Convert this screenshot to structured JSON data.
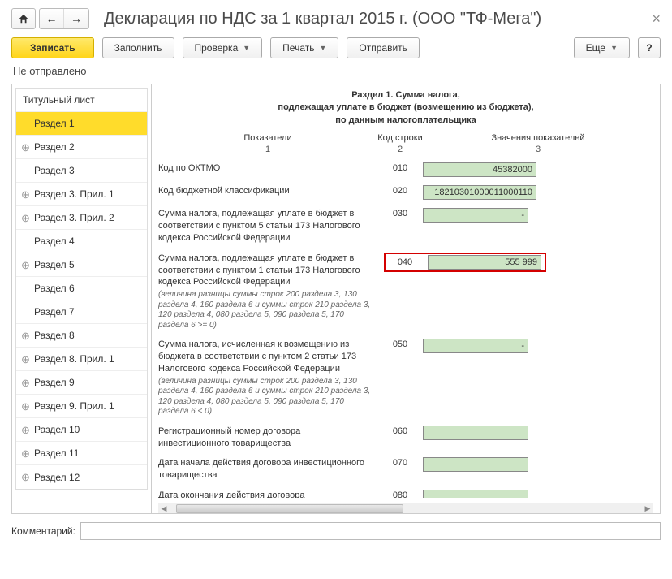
{
  "title": "Декларация по НДС за 1 квартал 2015 г. (ООО \"ТФ-Мега\")",
  "toolbar": {
    "record": "Записать",
    "fill": "Заполнить",
    "check": "Проверка",
    "print": "Печать",
    "send": "Отправить",
    "more": "Еще",
    "help": "?"
  },
  "status": "Не отправлено",
  "sidebar": [
    {
      "label": "Титульный лист",
      "expand": false,
      "first": true
    },
    {
      "label": "Раздел 1",
      "expand": false,
      "active": true
    },
    {
      "label": "Раздел 2",
      "expand": true
    },
    {
      "label": "Раздел 3",
      "expand": false
    },
    {
      "label": "Раздел 3. Прил. 1",
      "expand": true
    },
    {
      "label": "Раздел 3. Прил. 2",
      "expand": true
    },
    {
      "label": "Раздел 4",
      "expand": false
    },
    {
      "label": "Раздел 5",
      "expand": true
    },
    {
      "label": "Раздел 6",
      "expand": false
    },
    {
      "label": "Раздел 7",
      "expand": false
    },
    {
      "label": "Раздел 8",
      "expand": true
    },
    {
      "label": "Раздел 8. Прил. 1",
      "expand": true
    },
    {
      "label": "Раздел 9",
      "expand": true
    },
    {
      "label": "Раздел 9. Прил. 1",
      "expand": true
    },
    {
      "label": "Раздел 10",
      "expand": true
    },
    {
      "label": "Раздел 11",
      "expand": true
    },
    {
      "label": "Раздел 12",
      "expand": true
    }
  ],
  "section": {
    "header1": "Раздел 1. Сумма налога,",
    "header2": "подлежащая уплате в бюджет (возмещению из бюджета),",
    "header3": "по данным налогоплательщика",
    "cols": {
      "c1": "Показатели",
      "c2": "Код строки",
      "c3": "Значения показателей"
    },
    "subs": {
      "c1": "1",
      "c2": "2",
      "c3": "3"
    }
  },
  "rows": [
    {
      "label": "Код по ОКТМО",
      "code": "010",
      "value": "45382000"
    },
    {
      "label": "Код бюджетной классификации",
      "code": "020",
      "value": "18210301000011000110"
    },
    {
      "label": "Сумма налога, подлежащая уплате в бюджет в соответствии с пунктом 5 статьи 173 Налогового кодекса Российской Федерации",
      "code": "030",
      "value": "-"
    },
    {
      "label": "Сумма налога, подлежащая уплате в бюджет в соответствии с пунктом 1 статьи 173 Налогового кодекса Российской Федерации",
      "note": "(величина разницы суммы строк 200 раздела 3, 130 раздела 4, 160 раздела 6 и суммы строк 210 раздела 3, 120 раздела 4, 080 раздела 5, 090 раздела 5, 170 раздела 6 >= 0)",
      "code": "040",
      "value": "555 999",
      "highlight": true
    },
    {
      "label": "Сумма налога, исчисленная к возмещению из бюджета в соответствии с пунктом 2 статьи 173 Налогового кодекса Российской Федерации",
      "note": "(величина разницы суммы строк 200 раздела 3, 130 раздела 4, 160 раздела 6 и суммы строк 210 раздела 3, 120 раздела 4, 080 раздела 5, 090 раздела 5, 170 раздела 6 < 0)",
      "code": "050",
      "value": "-"
    },
    {
      "label": "Регистрационный номер договора инвестиционного товарищества",
      "code": "060",
      "value": ""
    },
    {
      "label": "Дата начала действия договора инвестиционного товарищества",
      "code": "070",
      "value": ""
    },
    {
      "label": "Дата окончания действия договора инвестиционного товарищества",
      "code": "080",
      "value": ""
    }
  ],
  "footer": {
    "label": "Комментарий:",
    "value": ""
  }
}
